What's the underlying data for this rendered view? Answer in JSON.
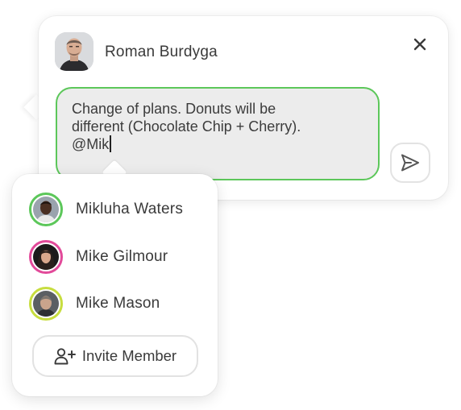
{
  "author": {
    "name": "Roman Burdyga"
  },
  "comment": {
    "text": "Change of plans. Donuts will be\ndifferent (Chocolate Chip + Cherry).\n@Mik"
  },
  "mention_suggestions": [
    {
      "name": "Mikluha Waters",
      "ring_color": "#5cc75a"
    },
    {
      "name": "Mike Gilmour",
      "ring_color": "#e24a9a"
    },
    {
      "name": "Mike Mason",
      "ring_color": "#c7dd3f"
    }
  ],
  "invite": {
    "label": "Invite Member",
    "icon": "add-user-icon"
  },
  "icons": {
    "close": "close-icon",
    "send": "send-icon"
  },
  "colors": {
    "accent_green": "#5cc75a",
    "input_bg": "#ececec",
    "text": "#3a3a3a"
  }
}
